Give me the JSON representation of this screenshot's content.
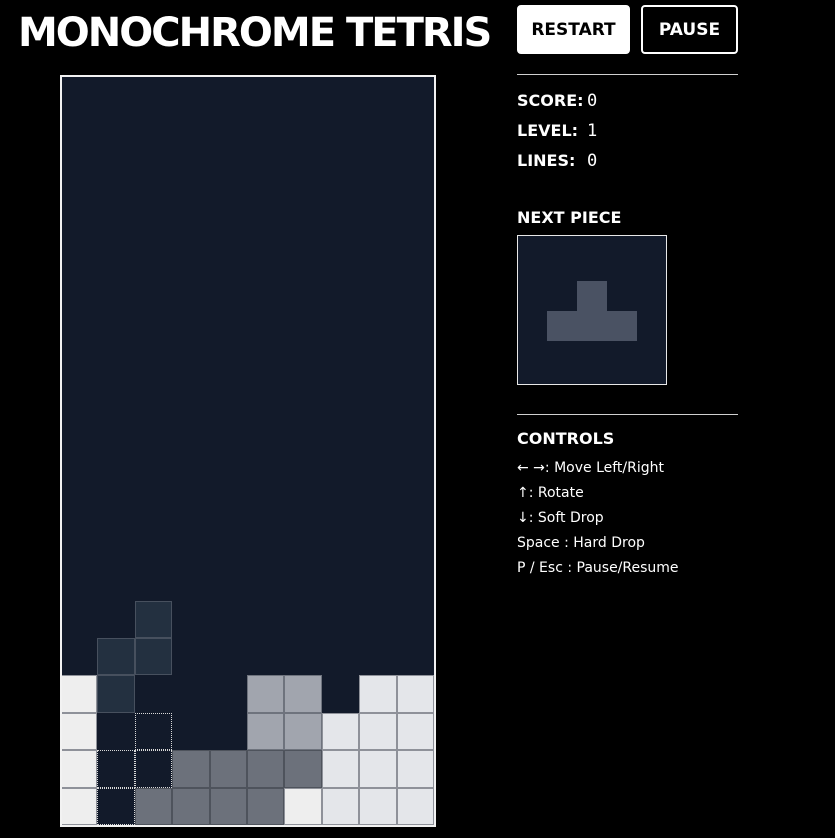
{
  "header": {
    "title": "MONOCHROME TETRIS",
    "restart_label": "RESTART",
    "pause_label": "PAUSE"
  },
  "stats": {
    "score_label": "SCORE:",
    "score": "0",
    "level_label": "LEVEL:",
    "level": "1",
    "lines_label": "LINES:",
    "lines": "0"
  },
  "next_piece": {
    "label": "NEXT PIECE",
    "shape": "T",
    "cells": [
      [
        1,
        0
      ],
      [
        0,
        1
      ],
      [
        1,
        1
      ],
      [
        2,
        1
      ]
    ]
  },
  "controls": {
    "title": "CONTROLS",
    "items": [
      "← →: Move Left/Right",
      "↑: Rotate",
      "↓: Soft Drop",
      "Space : Hard Drop",
      "P / Esc : Pause/Resume"
    ]
  },
  "board": {
    "columns": 10,
    "rows": 20,
    "colors": {
      "background": "#121a2a",
      "border": "#f2f2f2",
      "white": "#eeeeee",
      "light": "#e4e6ea",
      "mid": "#a1a5ae",
      "dark": "#6c717b",
      "active": "#233040"
    },
    "locked_cells": [
      {
        "row": 16,
        "col": 0,
        "shade": "white"
      },
      {
        "row": 16,
        "col": 5,
        "shade": "mid"
      },
      {
        "row": 16,
        "col": 6,
        "shade": "mid"
      },
      {
        "row": 16,
        "col": 8,
        "shade": "light"
      },
      {
        "row": 16,
        "col": 9,
        "shade": "light"
      },
      {
        "row": 17,
        "col": 0,
        "shade": "white"
      },
      {
        "row": 17,
        "col": 5,
        "shade": "mid"
      },
      {
        "row": 17,
        "col": 6,
        "shade": "mid"
      },
      {
        "row": 17,
        "col": 7,
        "shade": "light"
      },
      {
        "row": 17,
        "col": 8,
        "shade": "light"
      },
      {
        "row": 17,
        "col": 9,
        "shade": "light"
      },
      {
        "row": 18,
        "col": 0,
        "shade": "white"
      },
      {
        "row": 18,
        "col": 3,
        "shade": "dark"
      },
      {
        "row": 18,
        "col": 4,
        "shade": "dark"
      },
      {
        "row": 18,
        "col": 5,
        "shade": "dark"
      },
      {
        "row": 18,
        "col": 6,
        "shade": "dark"
      },
      {
        "row": 18,
        "col": 7,
        "shade": "light"
      },
      {
        "row": 18,
        "col": 8,
        "shade": "light"
      },
      {
        "row": 18,
        "col": 9,
        "shade": "light"
      },
      {
        "row": 19,
        "col": 0,
        "shade": "white"
      },
      {
        "row": 19,
        "col": 2,
        "shade": "dark"
      },
      {
        "row": 19,
        "col": 3,
        "shade": "dark"
      },
      {
        "row": 19,
        "col": 4,
        "shade": "dark"
      },
      {
        "row": 19,
        "col": 5,
        "shade": "dark"
      },
      {
        "row": 19,
        "col": 6,
        "shade": "white"
      },
      {
        "row": 19,
        "col": 7,
        "shade": "light"
      },
      {
        "row": 19,
        "col": 8,
        "shade": "light"
      },
      {
        "row": 19,
        "col": 9,
        "shade": "light"
      }
    ],
    "active_piece": {
      "shape": "S",
      "cells": [
        [
          14,
          2
        ],
        [
          15,
          1
        ],
        [
          15,
          2
        ],
        [
          16,
          1
        ]
      ]
    },
    "ghost_piece": {
      "cells": [
        [
          17,
          2
        ],
        [
          18,
          1
        ],
        [
          18,
          2
        ],
        [
          19,
          1
        ]
      ]
    }
  }
}
